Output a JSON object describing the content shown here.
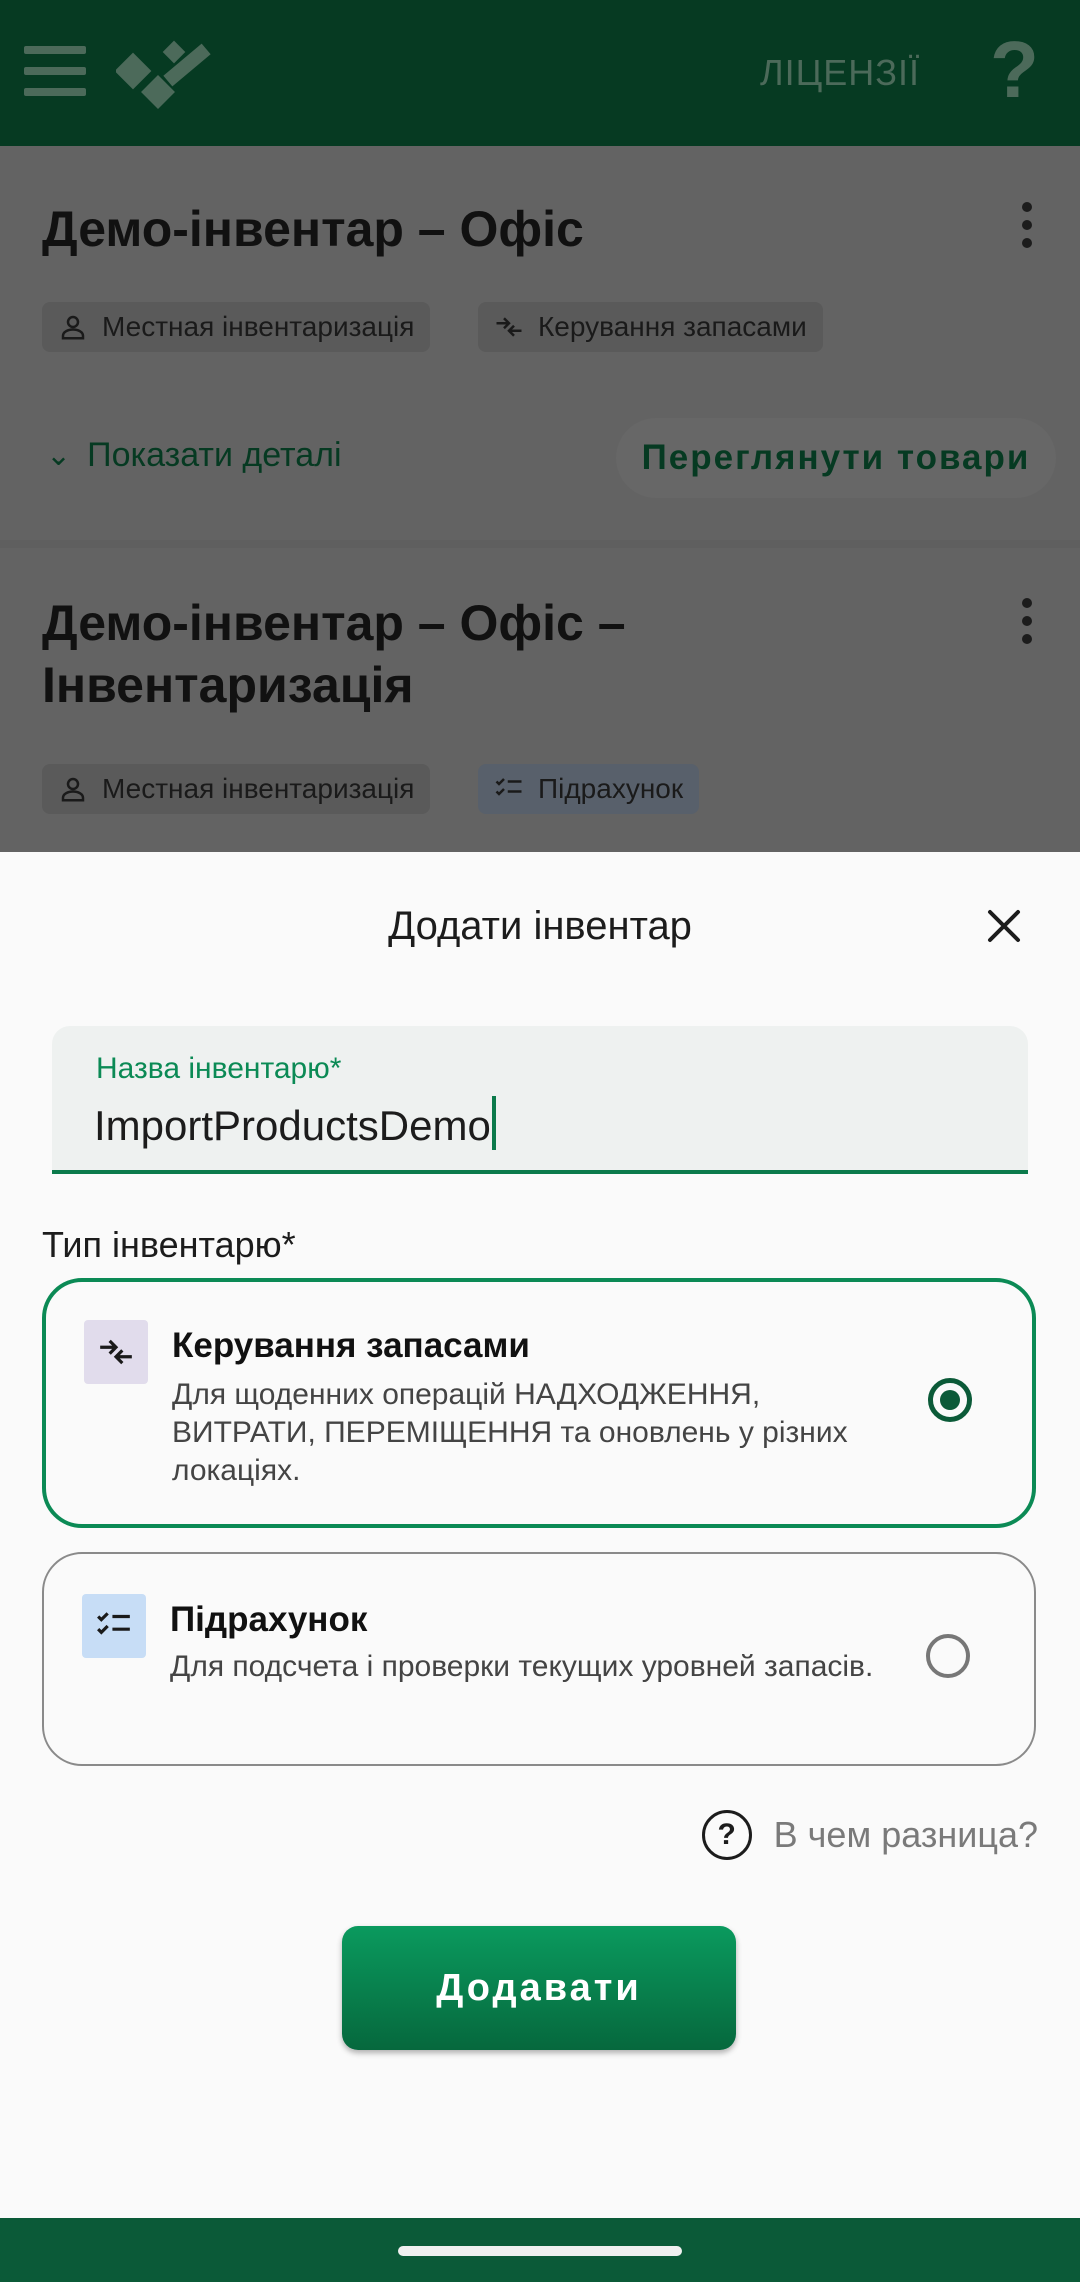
{
  "appbar": {
    "licenses_label": "ЛІЦЕНЗІЇ",
    "help_symbol": "?"
  },
  "inventories": [
    {
      "title": "Демо-інвентар – Офіс",
      "chips": [
        "Местная інвентаризація",
        "Керування запасами"
      ],
      "show_details_label": "Показати деталі",
      "browse_label": "Переглянути товари"
    },
    {
      "title": "Демо-інвентар – Офіс – Інвентаризація",
      "chips": [
        "Местная інвентаризація",
        "Підрахунок"
      ]
    }
  ],
  "sheet": {
    "title": "Додати інвентар",
    "name_field": {
      "label": "Назва інвентарю*",
      "value": "ImportProductsDemo"
    },
    "type_label": "Тип інвентарю*",
    "options": [
      {
        "title": "Керування запасами",
        "description": "Для щоденних операцій НАДХОДЖЕННЯ, ВИТРАТИ, ПЕРЕМІЩЕННЯ та оновлень у різних локаціях.",
        "selected": true
      },
      {
        "title": "Підрахунок",
        "description": "Для подсчета і проверки текущих уровней запасів.",
        "selected": false
      }
    ],
    "difference_label": "В чем разница?",
    "add_button_label": "Додавати"
  },
  "colors": {
    "primary": "#0b8a55",
    "appbar": "#063a22",
    "navbar": "#0b5a38"
  }
}
